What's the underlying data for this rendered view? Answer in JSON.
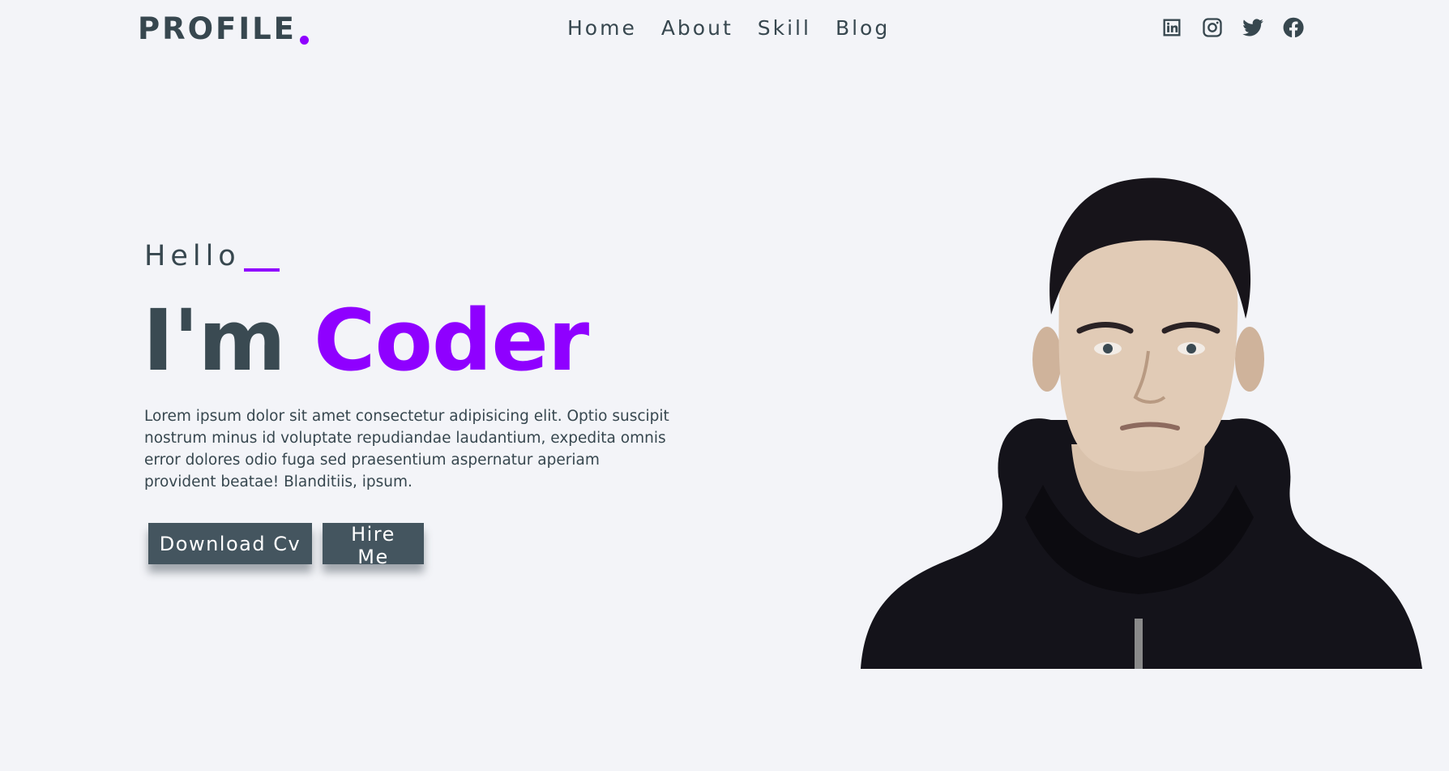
{
  "header": {
    "logo": "PROFILE",
    "nav": [
      "Home",
      "About",
      "Skill",
      "Blog"
    ],
    "social_icons": [
      "linkedin-icon",
      "instagram-icon",
      "twitter-icon",
      "facebook-icon"
    ]
  },
  "hero": {
    "greeting": "Hello",
    "headline_prefix": "I'm",
    "headline_accent": "Coder",
    "description": "Lorem ipsum dolor sit amet consectetur adipisicing elit. Optio suscipit nostrum minus id voluptate repudiandae laudantium, expedita omnis error dolores odio fuga sed praesentium aspernatur aperiam provident beatae! Blanditiis, ipsum.",
    "buttons": {
      "download": "Download Cv",
      "hire": "Hire Me"
    }
  },
  "colors": {
    "accent": "#8f00ff",
    "text": "#37474f",
    "button_bg": "#44555f",
    "background": "#f3f4f8"
  }
}
